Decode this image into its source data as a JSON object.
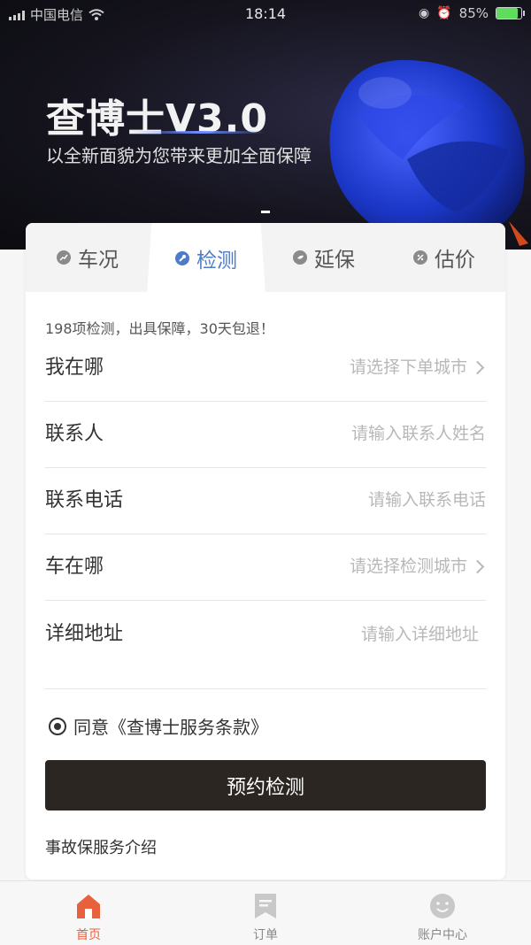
{
  "status_bar": {
    "carrier": "中国电信",
    "time": "18:14",
    "battery": "85%",
    "battery_level": 0.85
  },
  "banner": {
    "title": "查博士V3.0",
    "subtitle": "以全新面貌为您带来更加全面保障"
  },
  "tabs": [
    {
      "label": "车况",
      "icon": "chart-icon"
    },
    {
      "label": "检测",
      "icon": "wrench-icon"
    },
    {
      "label": "延保",
      "icon": "shield-icon"
    },
    {
      "label": "估价",
      "icon": "percent-icon"
    }
  ],
  "active_tab": 1,
  "form": {
    "tagline": "198项检测，出具保障，30天包退！",
    "rows": [
      {
        "label": "我在哪",
        "placeholder": "请选择下单城市",
        "arrow": true
      },
      {
        "label": "联系人",
        "placeholder": "请输入联系人姓名",
        "arrow": false
      },
      {
        "label": "联系电话",
        "placeholder": "请输入联系电话",
        "arrow": false
      },
      {
        "label": "车在哪",
        "placeholder": "请选择检测城市",
        "arrow": true
      },
      {
        "label": "详细地址",
        "placeholder": "请输入详细地址",
        "arrow": false
      }
    ],
    "agree_text": "同意《查博士服务条款》",
    "submit_label": "预约检测",
    "intro_link": "事故保服务介绍"
  },
  "bottom_nav": [
    {
      "label": "首页",
      "icon": "home-icon",
      "active": true
    },
    {
      "label": "订单",
      "icon": "bookmark-icon",
      "active": false
    },
    {
      "label": "账户中心",
      "icon": "smiley-icon",
      "active": false
    }
  ],
  "colors": {
    "accent_blue": "#4e7cc8",
    "nav_active": "#e8603c",
    "button_dark": "#2b2622"
  }
}
